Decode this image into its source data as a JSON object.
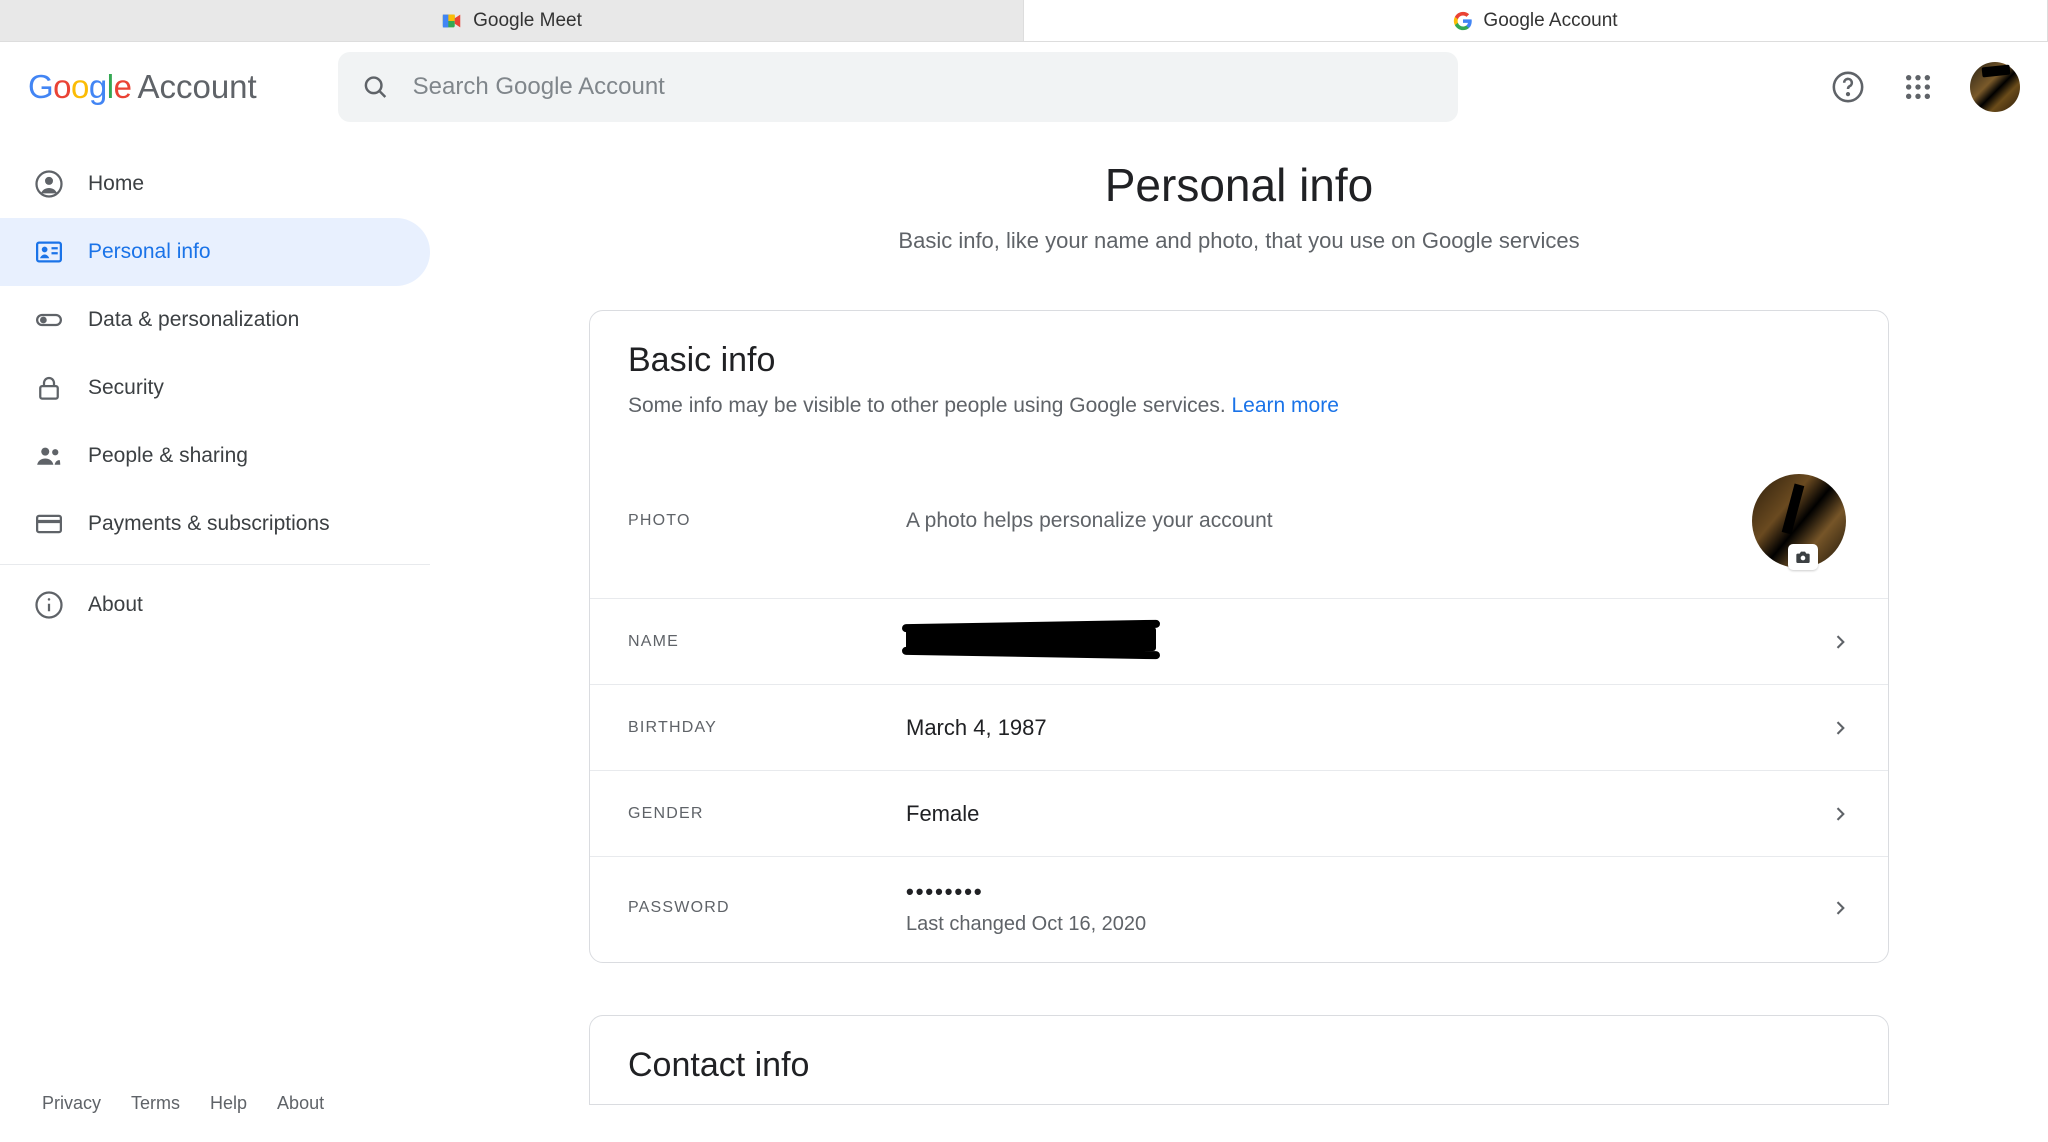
{
  "browser_tabs": [
    {
      "label": "Google Meet",
      "active": false
    },
    {
      "label": "Google Account",
      "active": true
    }
  ],
  "header": {
    "logo_suffix": "Account",
    "search_placeholder": "Search Google Account"
  },
  "sidebar": {
    "items": [
      {
        "label": "Home"
      },
      {
        "label": "Personal info"
      },
      {
        "label": "Data & personalization"
      },
      {
        "label": "Security"
      },
      {
        "label": "People & sharing"
      },
      {
        "label": "Payments & subscriptions"
      },
      {
        "label": "About"
      }
    ]
  },
  "footer": {
    "privacy": "Privacy",
    "terms": "Terms",
    "help": "Help",
    "about": "About"
  },
  "page": {
    "title": "Personal info",
    "subtitle": "Basic info, like your name and photo, that you use on Google services"
  },
  "basic_info": {
    "title": "Basic info",
    "subtitle": "Some info may be visible to other people using Google services. ",
    "learn_more": "Learn more",
    "rows": {
      "photo": {
        "label": "PHOTO",
        "value": "A photo helps personalize your account"
      },
      "name": {
        "label": "NAME"
      },
      "birthday": {
        "label": "BIRTHDAY",
        "value": "March 4, 1987"
      },
      "gender": {
        "label": "GENDER",
        "value": "Female"
      },
      "password": {
        "label": "PASSWORD",
        "value": "••••••••",
        "sub": "Last changed Oct 16, 2020"
      }
    }
  },
  "contact_info": {
    "title": "Contact info"
  }
}
